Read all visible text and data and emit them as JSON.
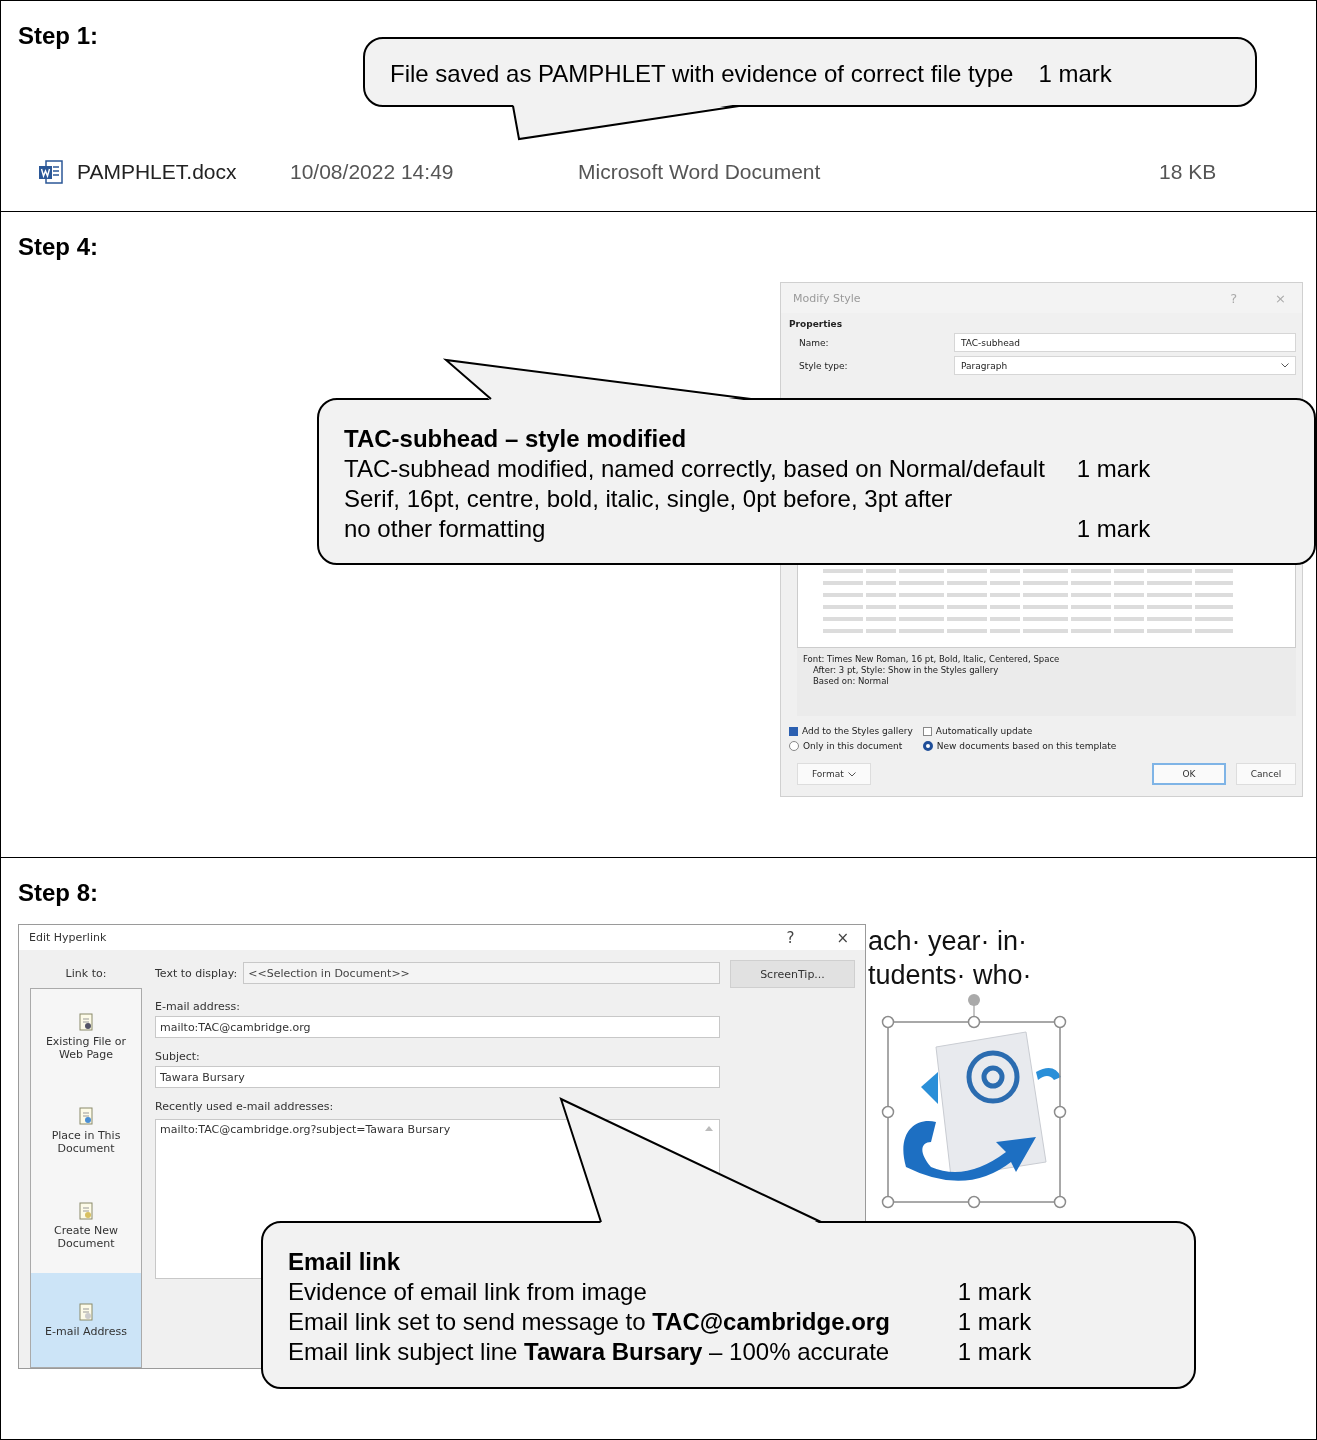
{
  "steps": [
    {
      "kind": "file",
      "title": "Step 1:",
      "callout": {
        "lines": [
          {
            "text": "File saved as PAMPHLET with evidence of correct file type",
            "mark": "1 mark"
          }
        ]
      },
      "file": {
        "name": "PAMPHLET.docx",
        "modified": "10/08/2022 14:49",
        "type": "Microsoft Word Document",
        "size": "18 KB"
      }
    },
    {
      "kind": "style",
      "title": "Step 4:",
      "callout": {
        "heading": "TAC-subhead – style modified",
        "lines": [
          {
            "text": "TAC-subhead modified, named correctly, based on Normal/default",
            "mark": "1 mark"
          },
          {
            "text": "Serif, 16pt, centre, bold, italic, single, 0pt before, 3pt after"
          },
          {
            "text": "no other formatting",
            "mark": "1 mark"
          }
        ]
      },
      "dialog": {
        "title": "Modify Style",
        "help": "?",
        "close": "×",
        "section": "Properties",
        "fields": [
          {
            "label": "Name:",
            "value": "TAC-subhead",
            "kind": "text"
          },
          {
            "label": "Style type:",
            "value": "Paragraph",
            "kind": "dropdown"
          }
        ],
        "description": [
          "Font: Times New Roman, 16 pt, Bold, Italic, Centered, Space",
          "After: 3 pt, Style: Show in the Styles gallery",
          "Based on: Normal"
        ],
        "options": [
          {
            "kind": "checkbox",
            "label": "Add to the Styles gallery",
            "checked": true
          },
          {
            "kind": "checkbox",
            "label": "Automatically update",
            "checked": false
          },
          {
            "kind": "radio",
            "label": "Only in this document",
            "selected": false
          },
          {
            "kind": "radio",
            "label": "New documents based on this template",
            "selected": true
          }
        ],
        "buttons": [
          "Format",
          "OK",
          "Cancel"
        ]
      }
    },
    {
      "kind": "hyperlink",
      "title": "Step 8:",
      "callout": {
        "heading": "Email link",
        "lines": [
          {
            "text": "Evidence of email link from image",
            "mark": "1 mark"
          },
          {
            "text": "Email link set to send message to **TAC@cambridge.org**",
            "mark": "1 mark"
          },
          {
            "text": "Email link subject line **Tawara Bursary** – 100% accurate",
            "mark": "1 mark"
          }
        ]
      },
      "dialog": {
        "title": "Edit Hyperlink",
        "help": "?",
        "close": "×",
        "link_to_label": "Link to:",
        "link_to": [
          {
            "label": "Existing File or Web Page",
            "selected": false
          },
          {
            "label": "Place in This Document",
            "selected": false
          },
          {
            "label": "Create New Document",
            "selected": false
          },
          {
            "label": "E-mail Address",
            "selected": true
          }
        ],
        "text_to_display": {
          "label": "Text to display:",
          "value": "<<Selection in Document>>"
        },
        "screentip": "ScreenTip...",
        "email": {
          "label": "E-mail address:",
          "value": "mailto:TAC@cambridge.org"
        },
        "subject": {
          "label": "Subject:",
          "value": "Tawara Bursary"
        },
        "recent": {
          "label": "Recently used e-mail addresses:",
          "items": [
            "mailto:TAC@cambridge.org?subject=Tawara Bursary"
          ]
        }
      },
      "document": {
        "lines": [
          "ach· year· in·",
          "tudents· who·"
        ]
      }
    }
  ]
}
